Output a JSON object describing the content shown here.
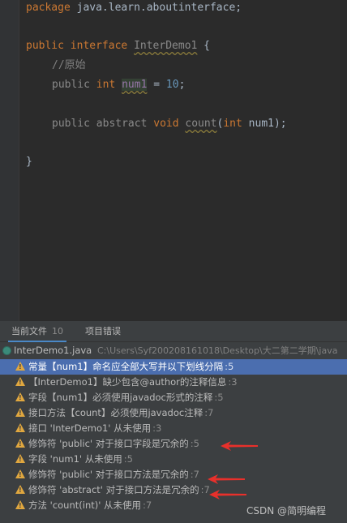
{
  "code": {
    "line1": {
      "kw": "package",
      "rest": " java.learn.aboutinterface;"
    },
    "line2": {
      "kw1": "public",
      "kw2": "interface",
      "name": "InterDemo1",
      "brace": " {"
    },
    "line3": {
      "comment": "//原始"
    },
    "line4": {
      "kw1": "public",
      "kw2": "int",
      "field": "num1",
      "eq": " = ",
      "value": "10",
      "semi": ";"
    },
    "line5": {
      "kw1": "public",
      "kw2": "abstract",
      "kw3": "void",
      "method": "count",
      "open": "(",
      "ptype": "int",
      "pname": " num1);"
    },
    "line6": {
      "brace": "}"
    }
  },
  "panel": {
    "tab_current": "当前文件",
    "tab_current_count": "10",
    "tab_project": "项目错误",
    "file_name": "InterDemo1.java",
    "file_path": "C:\\Users\\Syf200208161018\\Desktop\\大二第二学期\\java"
  },
  "issues": [
    {
      "text": "常量【num1】命名应全部大写并以下划线分隔",
      "line": ":5"
    },
    {
      "text": "【InterDemo1】缺少包含@author的注释信息",
      "line": ":3"
    },
    {
      "text": "字段【num1】必须使用javadoc形式的注释",
      "line": ":5"
    },
    {
      "text": "接口方法【count】必须使用javadoc注释",
      "line": ":7"
    },
    {
      "text": "接口 'InterDemo1' 从未使用",
      "line": ":3"
    },
    {
      "text": "修饰符 'public' 对于接口字段是冗余的",
      "line": ":5"
    },
    {
      "text": "字段 'num1' 从未使用",
      "line": ":5"
    },
    {
      "text": "修饰符 'public' 对于接口方法是冗余的",
      "line": ":7"
    },
    {
      "text": "修饰符 'abstract' 对于接口方法是冗余的",
      "line": ":7"
    },
    {
      "text": "方法 'count(int)' 从未使用",
      "line": ":7"
    }
  ],
  "colors": {
    "arrow": "#e8302b",
    "warning": "#e0a73f",
    "selection": "#4b6eaf"
  },
  "watermark": "CSDN @简明编程"
}
